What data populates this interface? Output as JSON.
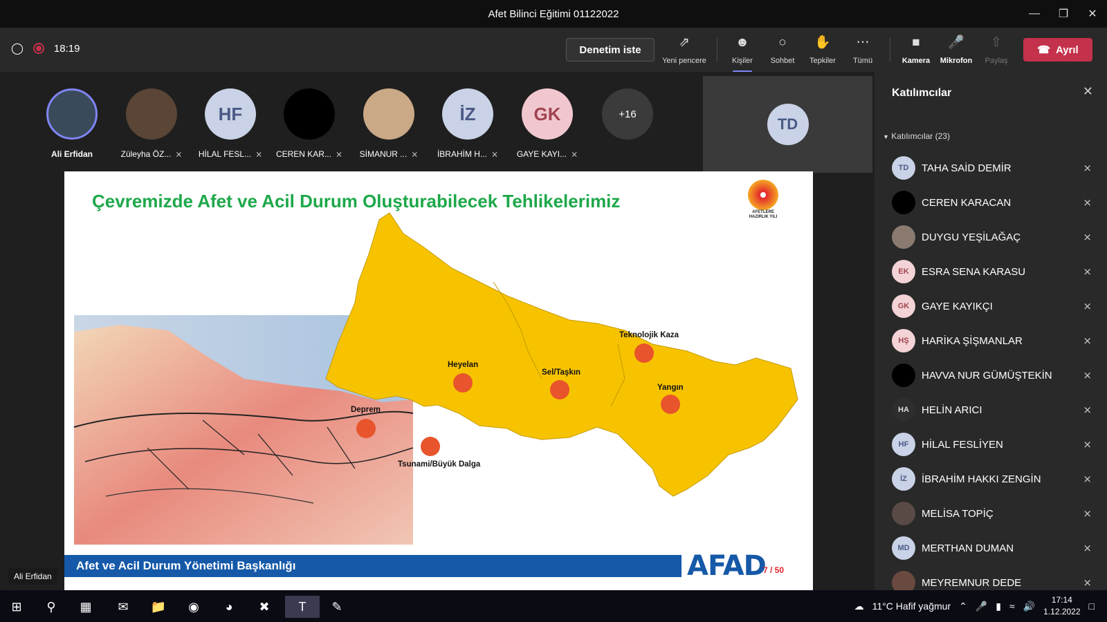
{
  "window": {
    "title": "Afet Bilinci Eğitimi 01122022"
  },
  "toolbar": {
    "time": "18:19",
    "take_control": "Denetim iste",
    "items": [
      {
        "label": "Yeni pencere",
        "icon": "popout-icon"
      },
      {
        "label": "Kişiler",
        "icon": "people-icon"
      },
      {
        "label": "Sohbet",
        "icon": "chat-icon"
      },
      {
        "label": "Tepkiler",
        "icon": "reactions-icon"
      },
      {
        "label": "Tümü",
        "icon": "more-icon"
      },
      {
        "label": "Kamera",
        "icon": "camera-off-icon"
      },
      {
        "label": "Mikrofon",
        "icon": "mic-off-icon"
      },
      {
        "label": "Paylaş",
        "icon": "share-icon"
      }
    ],
    "leave": "Ayrıl"
  },
  "strip": {
    "participants": [
      {
        "name": "Ali Erfidan",
        "initials": "",
        "bg": "#3a4a5a",
        "muted": false
      },
      {
        "name": "Züleyha ÖZ...",
        "initials": "",
        "bg": "#5a4536",
        "muted": true
      },
      {
        "name": "HİLAL FESL...",
        "initials": "HF",
        "bg": "#c9d2e6",
        "muted": true
      },
      {
        "name": "CEREN KAR...",
        "initials": "",
        "bg": "#000000",
        "muted": true
      },
      {
        "name": "SİMANUR ...",
        "initials": "",
        "bg": "#c9a986",
        "muted": true
      },
      {
        "name": "İBRAHİM H...",
        "initials": "İZ",
        "bg": "#c9d2e6",
        "muted": true
      },
      {
        "name": "GAYE KAYI...",
        "initials": "GK",
        "bg": "#f1c7cf",
        "muted": true
      }
    ],
    "overflow": "+16",
    "self_initials": "TD",
    "speaker": "Ali Erfidan"
  },
  "slide": {
    "title": "Çevremizde Afet ve Acil Durum Oluşturabilecek Tehlikelerimiz",
    "logo_text": "AFETLERE HAZIRLIK YILI",
    "hazards": [
      "Teknolojik Kaza",
      "Heyelan",
      "Sel/Taşkın",
      "Yangın",
      "Deprem",
      "Tsunami/Büyük Dalga"
    ],
    "footer": "Afet ve Acil Durum Yönetimi Başkanlığı",
    "brand": "AFAD",
    "page": "7 / 50"
  },
  "panel": {
    "title": "Katılımcılar",
    "section": "Katılımcılar (23)",
    "people": [
      {
        "name": "TAHA SAİD DEMİR",
        "initials": "TD",
        "bg": "#c9d2e6",
        "fg": "#4a5a85"
      },
      {
        "name": "CEREN KARACAN",
        "initials": "",
        "bg": "#000000",
        "fg": "#fff"
      },
      {
        "name": "DUYGU YEŞİLAĞAÇ",
        "initials": "",
        "bg": "#8a7a70",
        "fg": "#fff"
      },
      {
        "name": "ESRA SENA KARASU",
        "initials": "EK",
        "bg": "#f3d3d5",
        "fg": "#a04450"
      },
      {
        "name": "GAYE KAYIKÇI",
        "initials": "GK",
        "bg": "#f3d3d5",
        "fg": "#a04450"
      },
      {
        "name": "HARİKA ŞİŞMANLAR",
        "initials": "HŞ",
        "bg": "#f3d3d5",
        "fg": "#a04450"
      },
      {
        "name": "HAVVA NUR GÜMÜŞTEKİN",
        "initials": "",
        "bg": "#000000",
        "fg": "#fff"
      },
      {
        "name": "HELİN ARICI",
        "initials": "HA",
        "bg": "#2e2e2e",
        "fg": "#ddd"
      },
      {
        "name": "HİLAL FESLİYEN",
        "initials": "HF",
        "bg": "#c9d2e6",
        "fg": "#4a5a85"
      },
      {
        "name": "İBRAHİM HAKKI ZENGİN",
        "initials": "İZ",
        "bg": "#c9d2e6",
        "fg": "#4a5a85"
      },
      {
        "name": "MELİSA TOPİÇ",
        "initials": "",
        "bg": "#5a4a46",
        "fg": "#fff"
      },
      {
        "name": "MERTHAN DUMAN",
        "initials": "MD",
        "bg": "#c9d2e6",
        "fg": "#4a5a85"
      },
      {
        "name": "MEYREMNUR DEDE",
        "initials": "",
        "bg": "#6a4a40",
        "fg": "#fff"
      }
    ]
  },
  "taskbar": {
    "weather": "11°C  Hafif yağmur",
    "time": "17:14",
    "date": "1.12.2022"
  },
  "colors": {
    "accent": "#7f85f5",
    "leave": "#c4314b",
    "slide_green": "#1ea84a",
    "map_yellow": "#f7c300",
    "afad_blue": "#1559a8"
  }
}
